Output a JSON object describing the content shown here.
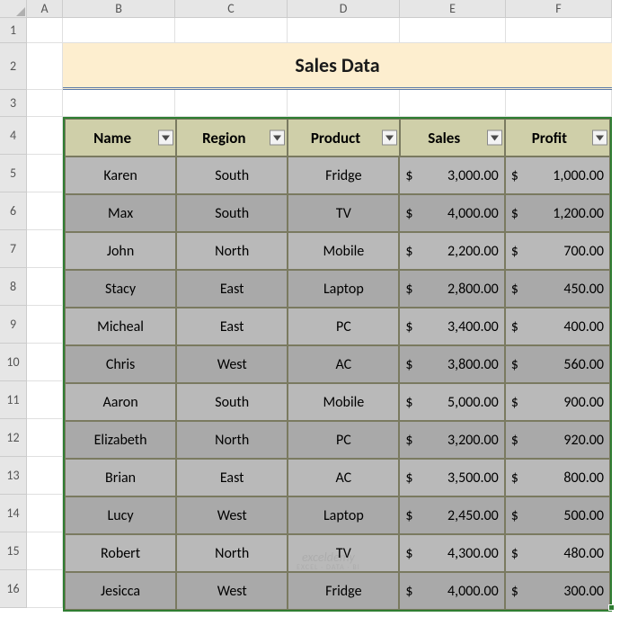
{
  "columns": [
    "A",
    "B",
    "C",
    "D",
    "E",
    "F"
  ],
  "rows": [
    "1",
    "2",
    "3",
    "4",
    "5",
    "6",
    "7",
    "8",
    "9",
    "10",
    "11",
    "12",
    "13",
    "14",
    "15",
    "16"
  ],
  "title": "Sales Data",
  "headers": {
    "name": "Name",
    "region": "Region",
    "product": "Product",
    "sales": "Sales",
    "profit": "Profit"
  },
  "currency": "$",
  "data": [
    {
      "name": "Karen",
      "region": "South",
      "product": "Fridge",
      "sales": "3,000.00",
      "profit": "1,000.00"
    },
    {
      "name": "Max",
      "region": "South",
      "product": "TV",
      "sales": "4,000.00",
      "profit": "1,200.00"
    },
    {
      "name": "John",
      "region": "North",
      "product": "Mobile",
      "sales": "2,200.00",
      "profit": "700.00"
    },
    {
      "name": "Stacy",
      "region": "East",
      "product": "Laptop",
      "sales": "2,800.00",
      "profit": "450.00"
    },
    {
      "name": "Micheal",
      "region": "East",
      "product": "PC",
      "sales": "3,400.00",
      "profit": "400.00"
    },
    {
      "name": "Chris",
      "region": "West",
      "product": "AC",
      "sales": "3,800.00",
      "profit": "560.00"
    },
    {
      "name": "Aaron",
      "region": "South",
      "product": "Mobile",
      "sales": "5,000.00",
      "profit": "900.00"
    },
    {
      "name": "Elizabeth",
      "region": "North",
      "product": "PC",
      "sales": "3,200.00",
      "profit": "920.00"
    },
    {
      "name": "Brian",
      "region": "East",
      "product": "AC",
      "sales": "3,500.00",
      "profit": "800.00"
    },
    {
      "name": "Lucy",
      "region": "West",
      "product": "Laptop",
      "sales": "2,450.00",
      "profit": "500.00"
    },
    {
      "name": "Robert",
      "region": "North",
      "product": "TV",
      "sales": "4,300.00",
      "profit": "480.00"
    },
    {
      "name": "Jesicca",
      "region": "West",
      "product": "Fridge",
      "sales": "4,000.00",
      "profit": "300.00"
    }
  ],
  "watermark": {
    "line1": "exceldemy",
    "line2": "EXCEL · DATA · BI"
  }
}
